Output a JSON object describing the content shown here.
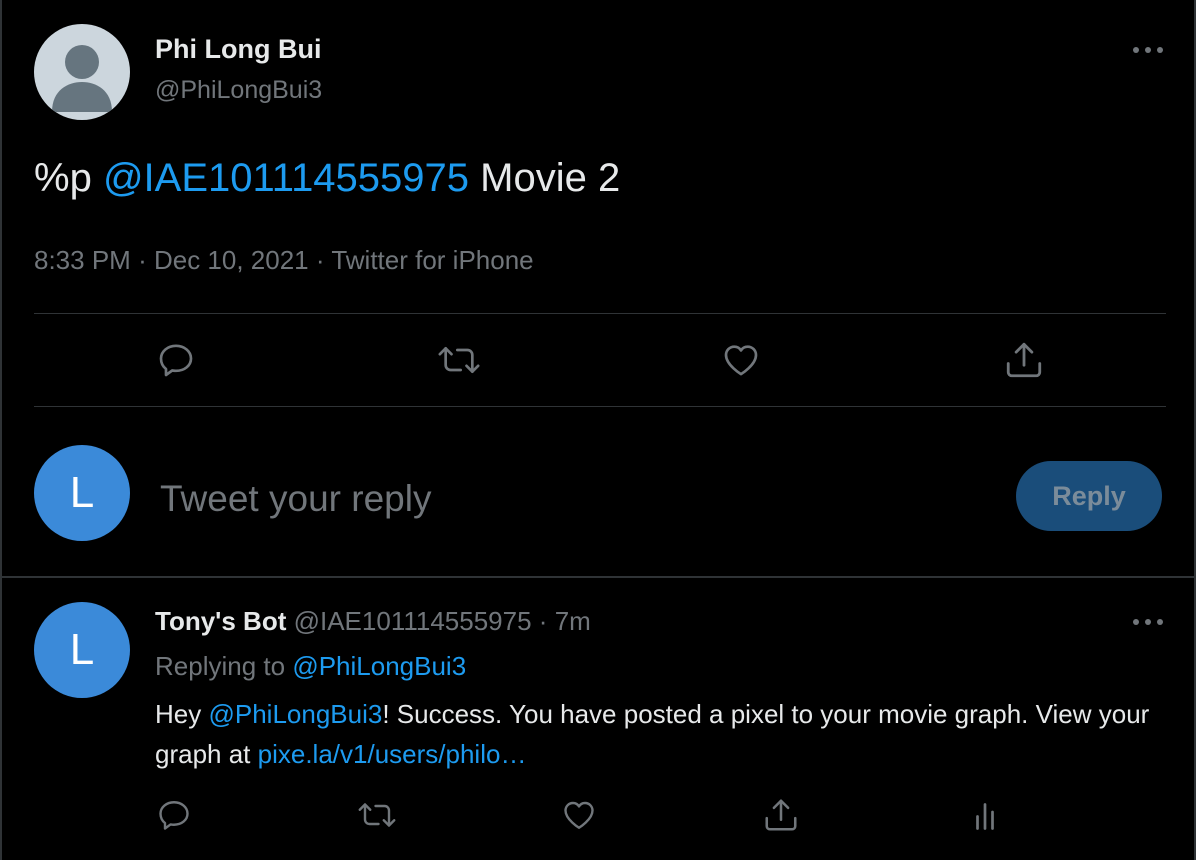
{
  "tweet": {
    "author_name": "Phi Long Bui",
    "author_handle": "@PhiLongBui3",
    "text_prefix": "%p",
    "mention": "@IAE101114555975",
    "text_suffix": "Movie 2",
    "time": "8:33 PM",
    "separator": "·",
    "date": "Dec 10, 2021",
    "source": "Twitter for iPhone"
  },
  "composer": {
    "avatar_letter": "L",
    "placeholder": "Tweet your reply",
    "reply_label": "Reply"
  },
  "reply": {
    "avatar_letter": "L",
    "author_name": "Tony's Bot",
    "author_handle": "@IAE101114555975",
    "separator": "·",
    "time": "7m",
    "replying_prefix": "Replying to",
    "replying_handle": "@PhiLongBui3",
    "body_prefix": "Hey",
    "body_mention": "@PhiLongBui3",
    "body_text": "! Success. You have posted a pixel to your movie graph. View your graph at",
    "body_link": "pixe.la/v1/users/philo…"
  },
  "colors": {
    "background": "#000000",
    "text": "#e7e9ea",
    "muted": "#71767b",
    "link": "#1d9bf0",
    "divider": "#2f3336",
    "avatar_blue": "#3b8ad9",
    "reply_button": "#1a4d7a"
  },
  "icons": [
    "more-icon",
    "reply-icon",
    "retweet-icon",
    "like-icon",
    "share-icon",
    "analytics-icon"
  ]
}
